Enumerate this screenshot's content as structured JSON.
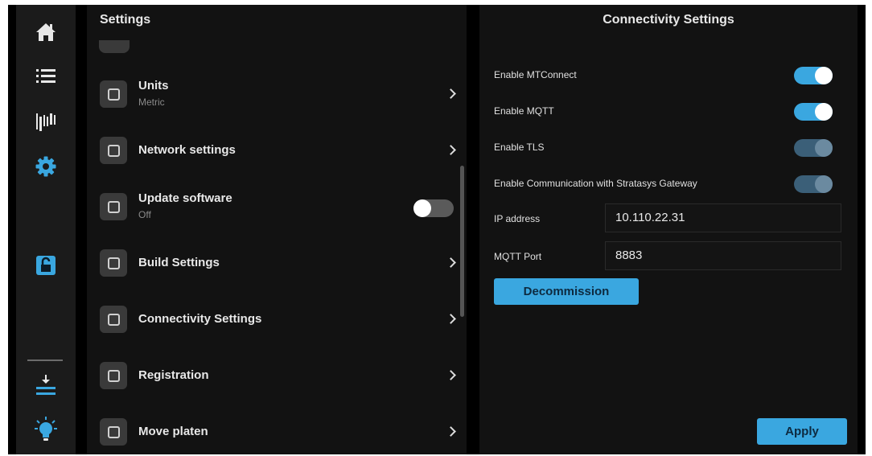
{
  "nav": {
    "icons": [
      "home-icon",
      "list-icon",
      "barcode-icon",
      "gear-icon",
      "unlock-icon",
      "download-tray-icon",
      "lightbulb-icon"
    ],
    "active": "gear-icon",
    "accent": "#3aa7e0"
  },
  "settings": {
    "title": "Settings",
    "items": [
      {
        "label": "Units",
        "sub": "Metric",
        "control": "chevron"
      },
      {
        "label": "Network settings",
        "sub": "",
        "control": "chevron"
      },
      {
        "label": "Update software",
        "sub": "Off",
        "control": "toggle-off"
      },
      {
        "label": "Build Settings",
        "sub": "",
        "control": "chevron"
      },
      {
        "label": "Connectivity Settings",
        "sub": "",
        "control": "chevron"
      },
      {
        "label": "Registration",
        "sub": "",
        "control": "chevron"
      },
      {
        "label": "Move platen",
        "sub": "",
        "control": "chevron"
      }
    ]
  },
  "connectivity": {
    "title": "Connectivity Settings",
    "toggles": [
      {
        "label": "Enable MTConnect",
        "state": "on"
      },
      {
        "label": "Enable MQTT",
        "state": "on"
      },
      {
        "label": "Enable TLS",
        "state": "on-disabled"
      },
      {
        "label": "Enable Communication with Stratasys Gateway",
        "state": "on-disabled"
      }
    ],
    "ip_label": "IP address",
    "ip_value": "10.110.22.31",
    "port_label": "MQTT Port",
    "port_value": "8883",
    "decommission_label": "Decommission",
    "apply_label": "Apply"
  }
}
